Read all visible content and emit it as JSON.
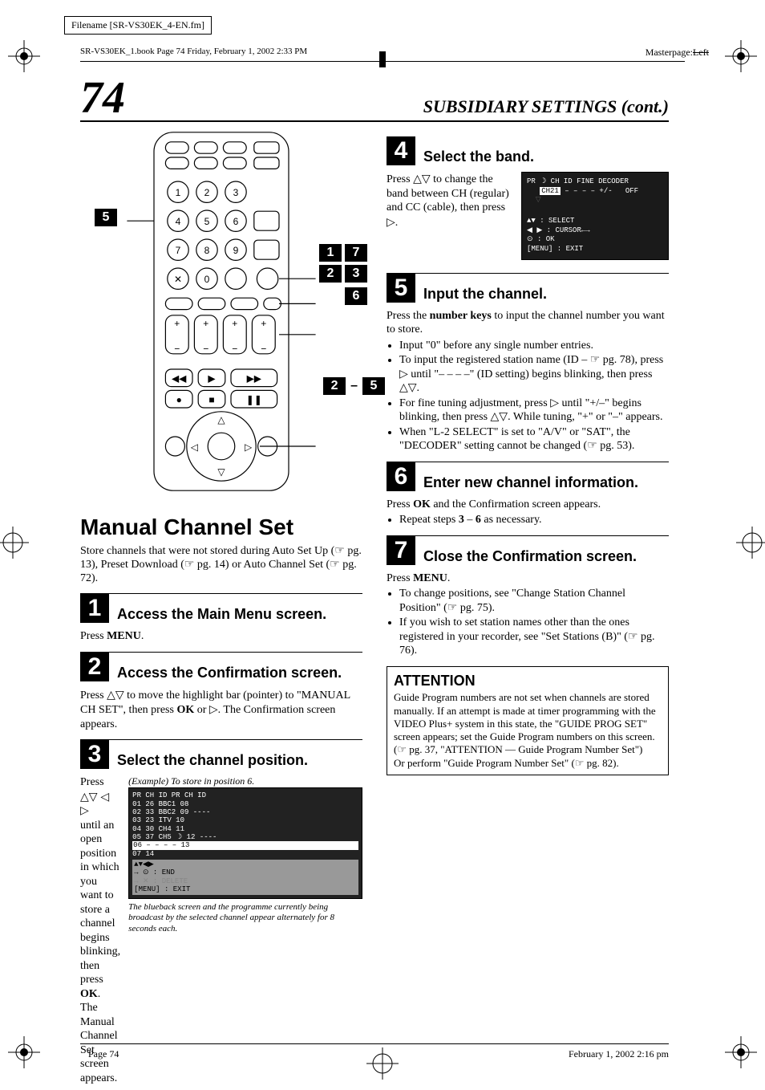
{
  "meta": {
    "filename": "Filename [SR-VS30EK_4-EN.fm]",
    "bookline": "SR-VS30EK_1.book  Page 74  Friday, February 1, 2002  2:33 PM",
    "masterpage_label": "Masterpage:",
    "masterpage_value": "Left",
    "page_number": "74",
    "section_header": "SUBSIDIARY SETTINGS (cont.)",
    "footer_left": "Page 74",
    "footer_right": "February 1, 2002 2:16 pm"
  },
  "left": {
    "callouts": {
      "c5": "5",
      "c1": "1",
      "c7": "7",
      "c2": "2",
      "c3": "3",
      "c6": "6",
      "c2b": "2",
      "dash": "–",
      "c5b": "5"
    },
    "title": "Manual Channel Set",
    "intro": "Store channels that were not stored during Auto Set Up (☞ pg. 13), Preset Download (☞ pg. 14) or Auto Channel Set (☞ pg. 72).",
    "step1": {
      "num": "1",
      "title": "Access the Main Menu screen.",
      "body": "Press MENU."
    },
    "step2": {
      "num": "2",
      "title": "Access the Confirmation screen.",
      "body": "Press △▽ to move the highlight bar (pointer) to \"MANUAL CH SET\", then press OK or ▷. The Confirmation screen appears."
    },
    "step3": {
      "num": "3",
      "title": "Select the channel position.",
      "text": "Press △▽ ◁ ▷ until an open position in which you want to store a channel begins blinking, then press OK. The Manual Channel Set screen appears.",
      "example": "(Example) To store in position 6.",
      "screen": {
        "hdr": "PR  CH   ID    PR  CH   ID",
        "r1": "01  26  BBC1   08",
        "r2": "02  33  BBC2   09  ----",
        "r3": "03  23  ITV    10",
        "r4": "04  30  CH4    11",
        "r5": "05  37  CH5 ☽  12  ----",
        "r6": "06   – – – –   13",
        "r7": "07            14",
        "ctl1": "▲▼◀▶",
        "ctl2": "→ ⊙ : END",
        "ctl3": "→ ✕ : DELETE",
        "ctl4": "[MENU] : EXIT"
      },
      "caption": "The blueback screen and the programme currently being broadcast by the selected channel appear alternately for 8 seconds each."
    }
  },
  "right": {
    "step4": {
      "num": "4",
      "title": "Select the band.",
      "body": "Press △▽ to change the band between CH (regular) and CC (cable), then press ▷.",
      "screen": {
        "l1": "PR ☽ CH    ID   FINE  DECODER",
        "l2": "   CH21  – – – – +/-    OFF",
        "l3": "▲▼  : SELECT",
        "l4": "◀ ▶ : CURSOR←→",
        "l5": "⊙  : OK",
        "l6": "[MENU] : EXIT"
      }
    },
    "step5": {
      "num": "5",
      "title": "Input the channel.",
      "body": "Press the number keys to input the channel number you want to store.",
      "bul1": "Input \"0\" before any single number entries.",
      "bul2": "To input the registered station name (ID – ☞ pg. 78), press ▷ until \"– – – –\" (ID setting) begins blinking, then press △▽.",
      "bul3": "For fine tuning adjustment, press ▷ until \"+/–\" begins blinking, then press △▽. While tuning, \"+\" or \"–\" appears.",
      "bul4": "When \"L-2 SELECT\" is set to \"A/V\" or \"SAT\", the \"DECODER\" setting cannot be changed (☞ pg. 53)."
    },
    "step6": {
      "num": "6",
      "title": "Enter new channel information.",
      "body": "Press OK and the Confirmation screen appears.",
      "bul1": "Repeat steps 3 – 6 as necessary."
    },
    "step7": {
      "num": "7",
      "title": "Close the Confirmation screen.",
      "body": "Press MENU.",
      "bul1": "To change positions, see \"Change Station Channel Position\" (☞ pg. 75).",
      "bul2": "If you wish to set station names other than the ones registered in your recorder, see \"Set Stations (B)\" (☞ pg. 76)."
    },
    "attention": {
      "title": "ATTENTION",
      "p1": "Guide Program numbers are not set when channels are stored manually. If an attempt is made at timer programming with the VIDEO Plus+ system in this state, the \"GUIDE PROG SET\" screen appears; set the Guide Program numbers on this screen. (☞ pg. 37, \"ATTENTION — Guide Program Number Set\")",
      "p2": "Or perform \"Guide Program Number Set\" (☞ pg. 82)."
    }
  }
}
